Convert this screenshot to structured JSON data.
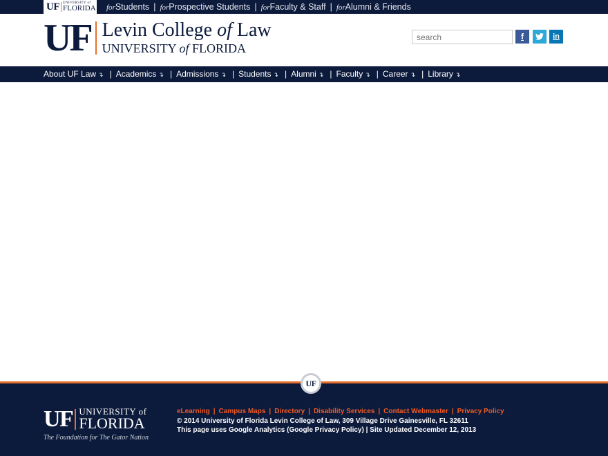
{
  "topbar": {
    "badge": {
      "uf": "UF",
      "university": "UNIVERSITY of",
      "florida": "FLORIDA"
    },
    "audience": [
      {
        "prefix": "for",
        "label": "Students"
      },
      {
        "prefix": "for",
        "label": "Prospective Students"
      },
      {
        "prefix": "for",
        "label": "Faculty & Staff"
      },
      {
        "prefix": "for",
        "label": "Alumni & Friends"
      }
    ],
    "separator": "|"
  },
  "header": {
    "logo_uf": "UF",
    "title_part1": "Levin College ",
    "title_of": "of",
    "title_part2": " Law",
    "subtitle_part1": "UNIVERSITY ",
    "subtitle_of": "of",
    "subtitle_part2": " FLORIDA",
    "search_placeholder": "search",
    "social": [
      {
        "icon": "facebook-icon",
        "glyph": "f",
        "color": "#3b5a99"
      },
      {
        "icon": "twitter-icon",
        "glyph": "t",
        "color": "#2da8d9"
      },
      {
        "icon": "linkedin-icon",
        "glyph": "in",
        "color": "#0976b4"
      }
    ]
  },
  "nav": {
    "arrow": "↴",
    "pipe": "|",
    "items": [
      "About UF Law",
      "Academics",
      "Admissions",
      "Students",
      "Alumni",
      "Faculty",
      "Career",
      "Library"
    ]
  },
  "footer": {
    "seal": "UF",
    "logo": {
      "uf": "UF",
      "university": "UNIVERSITY of",
      "florida": "FLORIDA",
      "tagline": "The Foundation for The Gator Nation"
    },
    "links": [
      "eLearning",
      "Campus Maps",
      "Directory",
      "Disability Services",
      "Contact Webmaster",
      "Privacy Policy"
    ],
    "separator": "|",
    "copyright": "© 2014 University of Florida Levin College of Law, 309 Village Drive Gainesville, FL 32611",
    "analytics": "This page uses Google Analytics (Google Privacy Policy) | Site Updated December 12, 2013"
  },
  "colors": {
    "navy": "#0c1a3c",
    "orange": "#e8702a",
    "link_orange": "#f05a22"
  }
}
